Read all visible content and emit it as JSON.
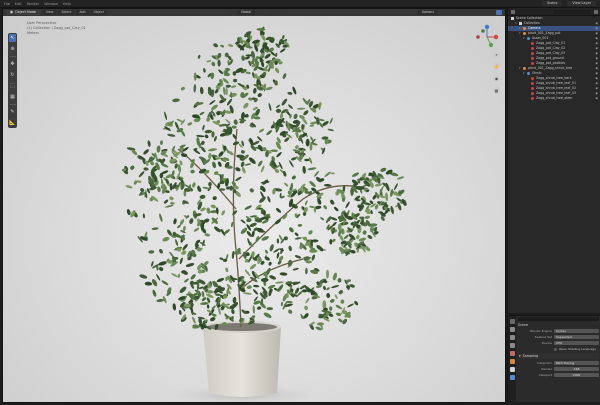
{
  "topbar": {
    "menu": [
      "File",
      "Edit",
      "Render",
      "Window",
      "Help"
    ],
    "scene": "Scene",
    "view_layer": "View Layer"
  },
  "viewport": {
    "mode": "Object Mode",
    "menus": [
      "View",
      "Select",
      "Add",
      "Object"
    ],
    "orientation": "Global",
    "options": "Options",
    "overlay_lines": [
      "User Perspective",
      "(1) Collection | Zagg_pot_Clay_01",
      "Meters"
    ]
  },
  "outliner": {
    "title": "Scene Collection",
    "rows": [
      {
        "label": "Collection",
        "indent": 1,
        "icon": "coll",
        "selected": false
      },
      {
        "label": "Camera",
        "indent": 2,
        "icon": "empty",
        "selected": true
      },
      {
        "label": "plant_001_Zagg_pot",
        "indent": 2,
        "icon": "empty",
        "selected": false
      },
      {
        "label": "Asset_001",
        "indent": 3,
        "icon": "mod",
        "selected": false
      },
      {
        "label": "Zagg_pot_Clay_01",
        "indent": 4,
        "icon": "mesh",
        "selected": false
      },
      {
        "label": "Zagg_pot_Clay_02",
        "indent": 4,
        "icon": "mesh",
        "selected": false
      },
      {
        "label": "Zagg_pot_Clay_03",
        "indent": 4,
        "icon": "mesh",
        "selected": false
      },
      {
        "label": "Zagg_pot_ground",
        "indent": 4,
        "icon": "mesh",
        "selected": false
      },
      {
        "label": "Zagg_pot_pebbles",
        "indent": 4,
        "icon": "mesh",
        "selected": false
      },
      {
        "label": "plant_001_Zagg_shrub_tree",
        "indent": 2,
        "icon": "empty",
        "selected": false
      },
      {
        "label": "Shrub",
        "indent": 3,
        "icon": "mod",
        "selected": false
      },
      {
        "label": "Zagg_shrub_tree_bark",
        "indent": 4,
        "icon": "mesh",
        "selected": false
      },
      {
        "label": "Zagg_shrub_tree_leaf_01",
        "indent": 4,
        "icon": "mesh",
        "selected": false
      },
      {
        "label": "Zagg_shrub_tree_leaf_02",
        "indent": 4,
        "icon": "mesh",
        "selected": false
      },
      {
        "label": "Zagg_shrub_tree_leaf_03",
        "indent": 4,
        "icon": "mesh",
        "selected": false
      },
      {
        "label": "Zagg_shrub_tree_stem",
        "indent": 4,
        "icon": "mesh",
        "selected": false
      }
    ]
  },
  "properties": {
    "title": "Scene",
    "render_engine_label": "Render Engine",
    "render_engine": "Cycles",
    "feature_set_label": "Feature Set",
    "feature_set": "Supported",
    "device_label": "Device",
    "device": "CPU",
    "osl_label": "Open Shading Language",
    "sampling_label": "Sampling",
    "integrator_label": "Integrator",
    "integrator": "Path Tracing",
    "render_label": "Render",
    "render_samples": "128",
    "viewport_label": "Viewport",
    "viewport_samples": "1000"
  },
  "colors": {
    "accent": "#4772b3",
    "selection": "#3b5280",
    "background": "#1d1d1d"
  }
}
